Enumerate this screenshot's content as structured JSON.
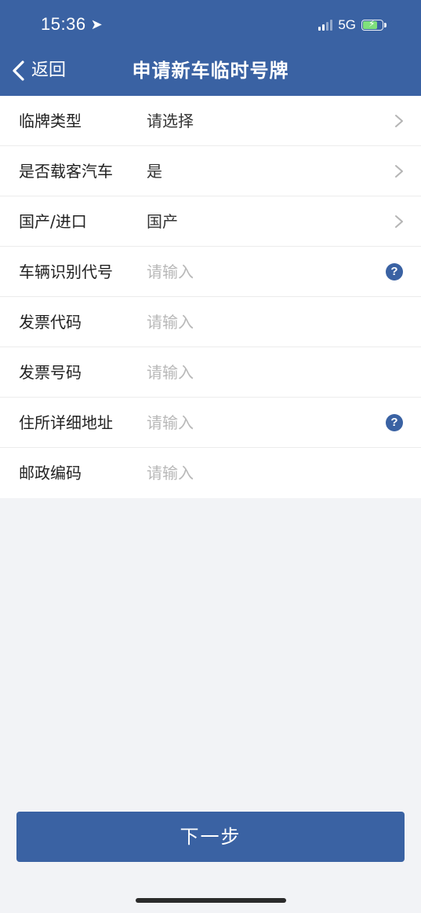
{
  "status_bar": {
    "time": "15:36",
    "location_glyph": "➤",
    "network": "5G",
    "battery_bolt": "⚡"
  },
  "nav": {
    "back_label": "返回",
    "title": "申请新车临时号牌"
  },
  "form": {
    "rows": [
      {
        "label": "临牌类型",
        "value": "请选择",
        "is_placeholder": false,
        "trailing": "chevron-right-icon"
      },
      {
        "label": "是否载客汽车",
        "value": "是",
        "is_placeholder": false,
        "trailing": "chevron-right-icon"
      },
      {
        "label": "国产/进口",
        "value": "国产",
        "is_placeholder": false,
        "trailing": "chevron-right-icon"
      },
      {
        "label": "车辆识别代号",
        "value": "请输入",
        "is_placeholder": true,
        "trailing": "help-icon"
      },
      {
        "label": "发票代码",
        "value": "请输入",
        "is_placeholder": true,
        "trailing": ""
      },
      {
        "label": "发票号码",
        "value": "请输入",
        "is_placeholder": true,
        "trailing": ""
      },
      {
        "label": "住所详细地址",
        "value": "请输入",
        "is_placeholder": true,
        "trailing": "help-icon"
      },
      {
        "label": "邮政编码",
        "value": "请输入",
        "is_placeholder": true,
        "trailing": ""
      }
    ],
    "help_glyph": "?"
  },
  "footer": {
    "next_label": "下一步"
  },
  "colors": {
    "brand": "#3a62a3",
    "placeholder": "#b8b8b8",
    "background": "#f2f3f6"
  }
}
